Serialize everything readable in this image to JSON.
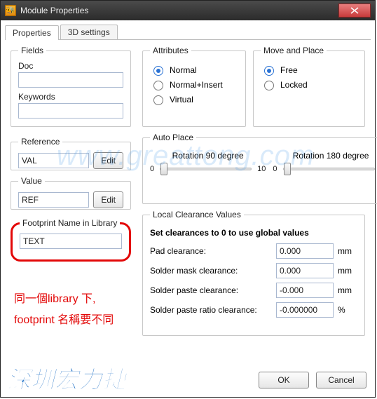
{
  "window": {
    "title": "Module Properties"
  },
  "tabs": {
    "properties": "Properties",
    "threed": "3D settings"
  },
  "fields": {
    "legend": "Fields",
    "doc_label": "Doc",
    "doc_value": "",
    "keywords_label": "Keywords",
    "keywords_value": ""
  },
  "reference": {
    "legend": "Reference",
    "value": "VAL",
    "edit": "Edit"
  },
  "value": {
    "legend": "Value",
    "value": "REF",
    "edit": "Edit"
  },
  "footprint": {
    "legend": "Footprint Name in Library",
    "value": "TEXT"
  },
  "attributes": {
    "legend": "Attributes",
    "normal": "Normal",
    "normal_insert": "Normal+Insert",
    "virtual": "Virtual",
    "selected": "normal"
  },
  "move": {
    "legend": "Move and Place",
    "free": "Free",
    "locked": "Locked",
    "selected": "free"
  },
  "auto": {
    "legend": "Auto Place",
    "rot90_label": "Rotation 90 degree",
    "rot180_label": "Rotation 180 degree",
    "min": "0",
    "max": "10",
    "rot90_value": 0,
    "rot180_value": 0
  },
  "lcl": {
    "legend": "Local Clearance Values",
    "head": "Set clearances to 0 to use global values",
    "pad_label": "Pad clearance:",
    "pad_value": "0.000",
    "pad_unit": "mm",
    "mask_label": "Solder mask clearance:",
    "mask_value": "0.000",
    "mask_unit": "mm",
    "paste_label": "Solder paste clearance:",
    "paste_value": "-0.000",
    "paste_unit": "mm",
    "ratio_label": "Solder paste ratio clearance:",
    "ratio_value": "-0.000000",
    "ratio_unit": "%"
  },
  "footer": {
    "ok": "OK",
    "cancel": "Cancel"
  },
  "annotation": {
    "line1": "同一個library 下,",
    "line2": "footprint 名稱要不同"
  },
  "watermark": "www.greattong.com",
  "brand": "深圳宏力捷"
}
